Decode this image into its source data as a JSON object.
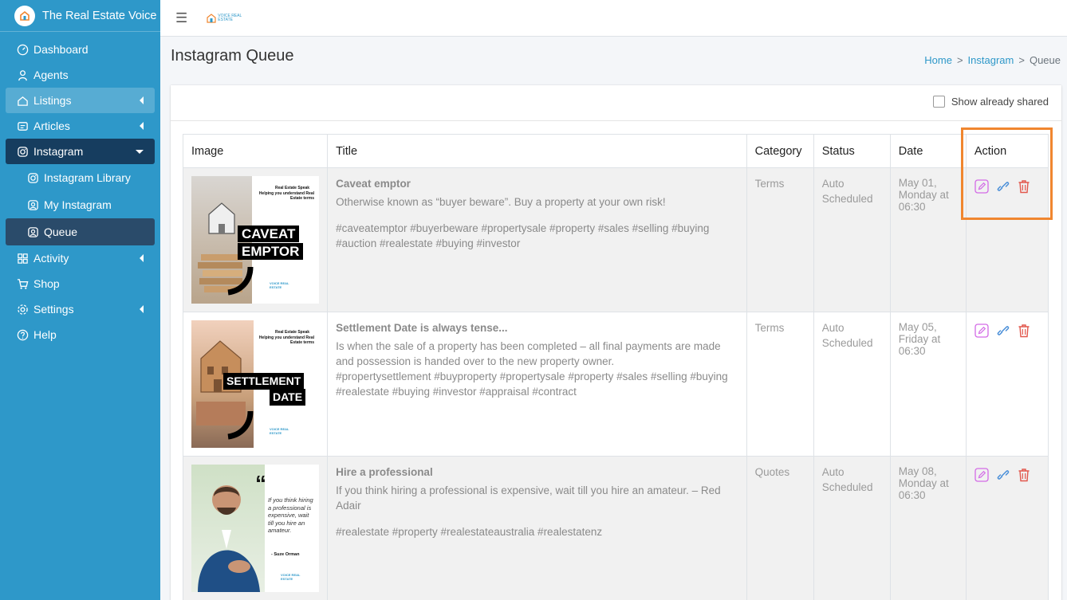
{
  "brand": {
    "name": "The Real Estate Voice"
  },
  "sidebar": {
    "items": [
      {
        "label": "Dashboard",
        "icon": "dashboard-icon"
      },
      {
        "label": "Agents",
        "icon": "agents-icon"
      },
      {
        "label": "Listings",
        "icon": "listings-icon"
      },
      {
        "label": "Articles",
        "icon": "articles-icon"
      },
      {
        "label": "Instagram",
        "icon": "instagram-icon"
      },
      {
        "label": "Instagram Library",
        "icon": "instagram-icon"
      },
      {
        "label": "My Instagram",
        "icon": "my-instagram-icon"
      },
      {
        "label": "Queue",
        "icon": "queue-icon"
      },
      {
        "label": "Activity",
        "icon": "activity-icon"
      },
      {
        "label": "Shop",
        "icon": "cart-icon"
      },
      {
        "label": "Settings",
        "icon": "settings-icon"
      },
      {
        "label": "Help",
        "icon": "help-icon"
      }
    ]
  },
  "topbar": {
    "logo_text": "VOICE REAL ESTATE"
  },
  "page": {
    "title": "Instagram Queue"
  },
  "breadcrumb": {
    "home": "Home",
    "sep": ">",
    "section": "Instagram",
    "current": "Queue"
  },
  "filter": {
    "show_shared_label": "Show already shared"
  },
  "table": {
    "headers": {
      "image": "Image",
      "title": "Title",
      "category": "Category",
      "status": "Status",
      "date": "Date",
      "action": "Action"
    },
    "rows": [
      {
        "title": "Caveat emptor",
        "description": "Otherwise known as “buyer beware”. Buy a property at your own risk!",
        "hashtags": "#caveatemptor #buyerbeware #propertysale #property #sales #selling #buying #auction #realestate #buying #investor",
        "category": "Terms",
        "status": "Auto Scheduled",
        "date": "May 01, Monday at 06:30",
        "thumb": {
          "small": "Real Estate Speak",
          "sub": "Helping you understand Real Estate terms",
          "big1": "CAVEAT",
          "big2": "EMPTOR",
          "logo": "VOICE REAL ESTATE"
        }
      },
      {
        "title": "Settlement Date is always tense...",
        "description": "Is when the sale of a property has been completed – all final payments are made and possession is handed over to the new property owner.",
        "hashtags": "#propertysettlement #buyproperty #propertysale #property #sales #selling #buying #realestate #buying #investor #appraisal #contract",
        "category": "Terms",
        "status": "Auto Scheduled",
        "date": "May 05, Friday at 06:30",
        "thumb": {
          "small": "Real Estate Speak",
          "sub": "Helping you understand Real Estate terms",
          "big1": "SETTLEMENT",
          "big2": "DATE",
          "logo": "VOICE REAL ESTATE"
        }
      },
      {
        "title": "Hire a professional",
        "description": "If you think hiring a professional is expensive, wait till you hire an amateur. – Red Adair",
        "hashtags": "#realestate #property #realestateaustralia #realestatenz",
        "category": "Quotes",
        "status": "Auto Scheduled",
        "date": "May 08, Monday at 06:30",
        "thumb": {
          "quote": "If you think hiring a professional is expensive, wait till you hire an amateur.",
          "author": "- Suze Orman",
          "logo": "VOICE REAL ESTATE"
        }
      }
    ]
  },
  "colors": {
    "sidebar": "#2e98c9",
    "active": "#163d5f",
    "highlight": "#f0862f",
    "edit": "#d36be6",
    "link": "#4a8fd8",
    "delete": "#e2574c"
  }
}
